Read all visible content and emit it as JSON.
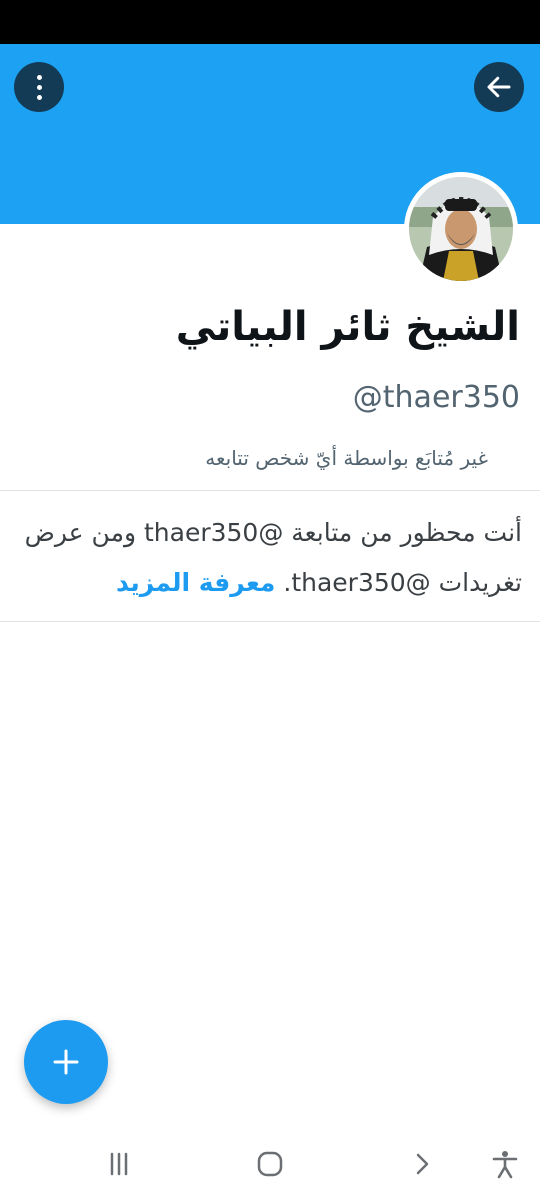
{
  "profile": {
    "name": "الشيخ ثائر البياتي",
    "handle": "@thaer350",
    "not_followed_text": "غير مُتابَع بواسطة أيّ شخص تتابعه",
    "avatar_description": "profile-avatar"
  },
  "blocked_notice": {
    "message": "أنت محظور من متابعة @thaer350 ومن عرض تغريدات @thaer350.",
    "learn_more": "معرفة المزيد"
  },
  "icons": {
    "back": "arrow-left-icon",
    "menu": "more-vertical-icon",
    "fab": "plus-icon",
    "nav": [
      "recent-apps-icon",
      "home-icon",
      "back-chevron-icon",
      "accessibility-icon"
    ]
  },
  "colors": {
    "banner": "#1da1f2",
    "accent": "#1d9bf0",
    "status_bar": "#000000"
  }
}
